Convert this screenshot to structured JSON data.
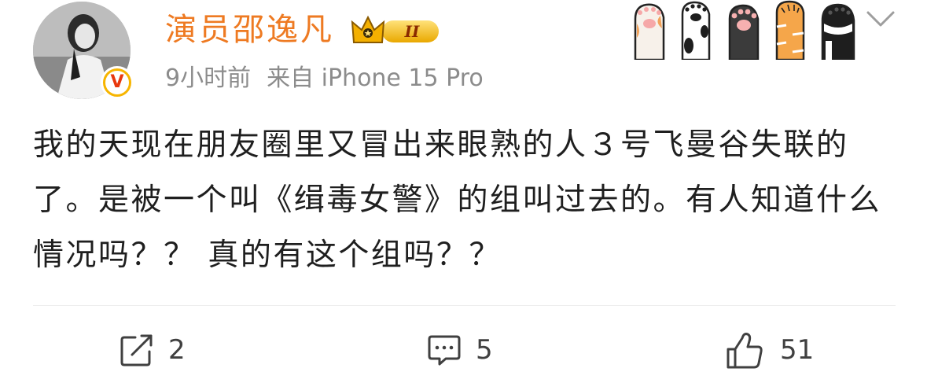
{
  "user": {
    "name": "演员邵逸凡",
    "vip_level": "II",
    "verified_mark": "V"
  },
  "meta": {
    "time": "9小时前",
    "source": "来自 iPhone 15 Pro"
  },
  "content": {
    "text": "我的天现在朋友圈里又冒出来眼熟的人３号飞曼谷失联的了。是被一个叫《缉毒女警》的组叫过去的。有人知道什么情况吗？？ 真的有这个组吗？？"
  },
  "actions": {
    "repost_count": "2",
    "comment_count": "5",
    "like_count": "51"
  },
  "icons": {
    "repost": "repost-icon",
    "comment": "comment-icon",
    "like": "thumbs-up-icon",
    "follow": "chevron-down-icon",
    "vip": "crown-badge-icon",
    "decoration": "cat-paws-decoration"
  },
  "colors": {
    "username": "#ee7a22",
    "meta": "#8c8c8c",
    "text": "#1f1f1f",
    "verified": "#f7b500"
  }
}
